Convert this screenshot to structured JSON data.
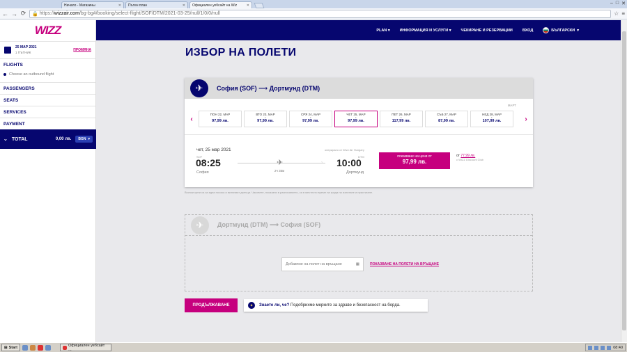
{
  "browser": {
    "tabs": [
      {
        "label": "Начало - Магазины",
        "active": false
      },
      {
        "label": "Пътен план",
        "active": false
      },
      {
        "label": "Официален уебсайт на Wiz",
        "active": true
      }
    ],
    "url_scheme": "https://",
    "url_host": "wizzair.com",
    "url_path": "/bg-bg#/booking/select-flight/SOF/DTM/2021-03-25/null/1/0/0/null"
  },
  "sidebar": {
    "logo": "WIZZ",
    "date": "25 МАР 2021",
    "passengers": "1 ПЪТНИК",
    "change": "ПРОМЯНА",
    "flights_title": "FLIGHTS",
    "flights_sub": "Choose an outbound flight",
    "sections": [
      "PASSENGERS",
      "SEATS",
      "SERVICES",
      "PAYMENT"
    ],
    "total_label": "TOTAL",
    "total_amount": "0,00 лв.",
    "currency": "BGN"
  },
  "topnav": {
    "items": [
      "PLAN",
      "ИНФОРМАЦИЯ И УСЛУГИ",
      "ЧЕКИРАНЕ И РЕЗЕРВАЦИИ",
      "ВХОД"
    ],
    "language": "БЪЛГАРСКИ"
  },
  "main": {
    "title": "ИЗБОР НА ПОЛЕТИ",
    "outbound": {
      "from": "София (SOF)",
      "arrow": "⟶",
      "to": "Дортмунд (DTM)",
      "month": "МАРТ",
      "days": [
        {
          "label": "ПОН 22, МАР",
          "price": "97,99 лв.",
          "selected": false
        },
        {
          "label": "ВТО 23, МАР",
          "price": "97,99 лв.",
          "selected": false
        },
        {
          "label": "СРЯ 24, МАР",
          "price": "97,99 лв.",
          "selected": false
        },
        {
          "label": "ЧЕТ 25, МАР",
          "price": "97,99 лв.",
          "selected": true
        },
        {
          "label": "ПЕТ 26, МАР",
          "price": "117,99 лв.",
          "selected": false
        },
        {
          "label": "СЪБ 27, МАР",
          "price": "87,99 лв.",
          "selected": false
        },
        {
          "label": "НЕД 28, МАР",
          "price": "107,99 лв.",
          "selected": false
        }
      ],
      "flight": {
        "date": "чет, 25 мар 2021",
        "operated_by": "оперирано от Wizz Air Hungary",
        "dep_label": "SOF",
        "dep_time": "08:25",
        "dep_city": "София",
        "duration": "2ч 35м",
        "arr_label": "DTM",
        "arr_time": "10:00",
        "arr_city": "Дортмунд",
        "price_label": "показване на цени от",
        "price": "97,99 лв.",
        "discount_prefix": "от",
        "discount_price": "77,99 лв.",
        "discount_club": "с WIZZ Discount Club"
      },
      "note": "Всички цени са за една посока и включват данъци. Часовете, показани в разписанието, са в местното време на града на излитане и пристигане."
    },
    "return": {
      "from": "Дортмунд (DTM)",
      "arrow": "⟶",
      "to": "София (SOF)",
      "field_placeholder": "Добавяне на полет на връщане",
      "link": "ПОКАЗВАНЕ НА ПОЛЕТИ НА ВРЪЩАНЕ"
    },
    "continue_label": "ПРОДЪЛЖАВАНЕ",
    "tip_bold": "Знаете ли, че?",
    "tip_text": "Подобрихме мерките за здраве и безопасност на борда."
  },
  "taskbar": {
    "start": "Start",
    "task": "Официален уебсайт ...",
    "clock": "08:40"
  },
  "colors": {
    "brand_navy": "#06066f",
    "brand_magenta": "#c6007e"
  }
}
